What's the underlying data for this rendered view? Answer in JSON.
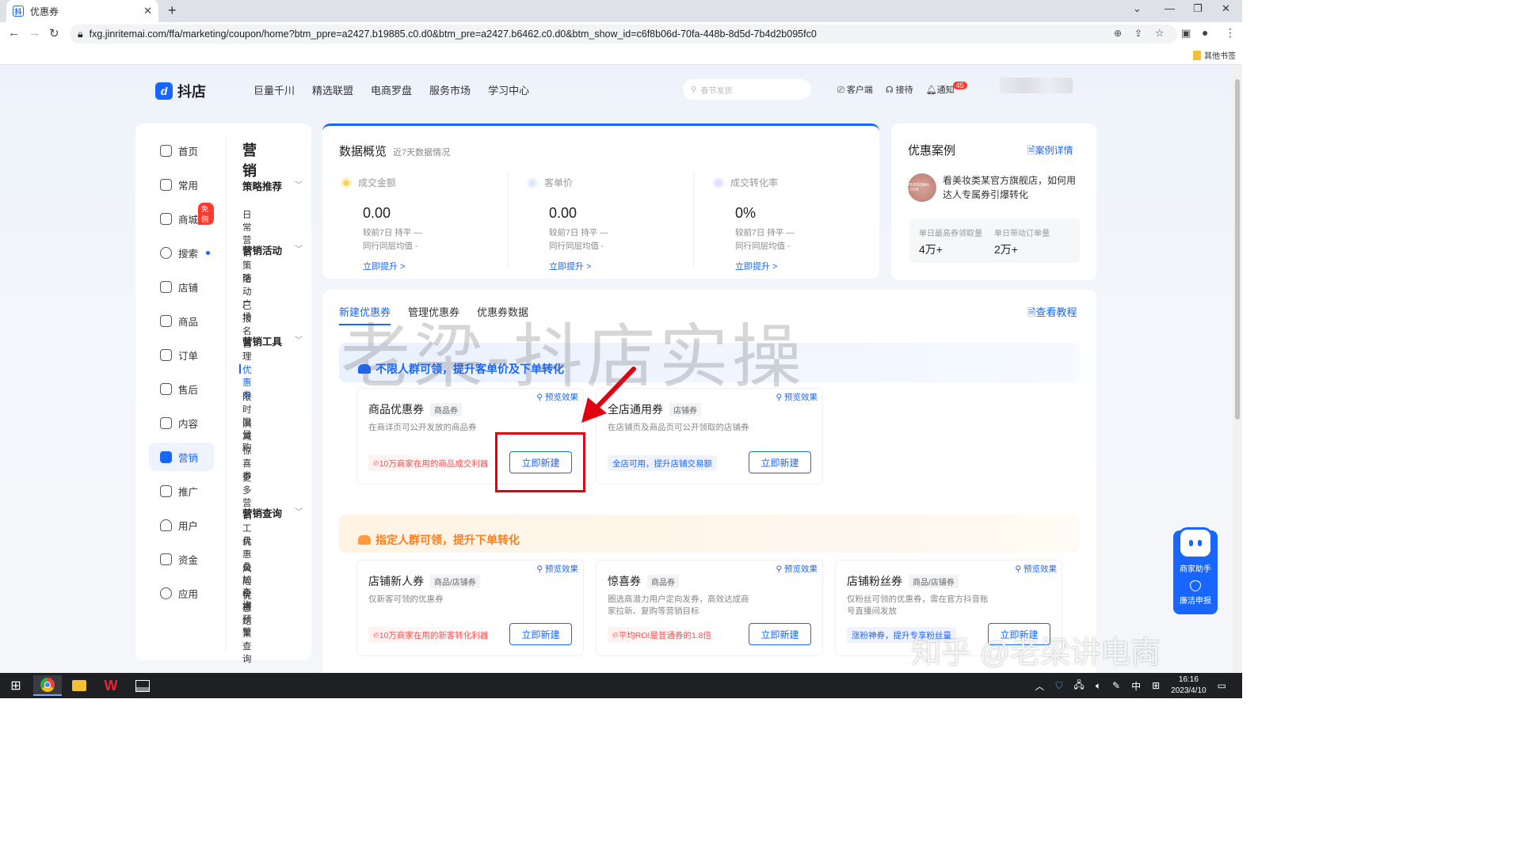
{
  "browser": {
    "tab_title": "优惠券",
    "tab_favicon": "抖",
    "url": "fxg.jinritemai.com/ffa/marketing/coupon/home?btm_ppre=a2427.b19885.c0.d0&btm_pre=a2427.b6462.c0.d0&btm_show_id=c6f8b06d-70fa-448b-8d5d-7b4d2b095fc0",
    "bookmarks_other": "其他书签"
  },
  "header": {
    "logo_text": "抖店",
    "nav": [
      "巨量千川",
      "精选联盟",
      "电商罗盘",
      "服务市场",
      "学习中心"
    ],
    "search_placeholder": "春节发货",
    "right": {
      "service": "客户端",
      "reception": "接待",
      "notice": "通知",
      "notice_badge": "45"
    }
  },
  "sidebar": {
    "primary": [
      {
        "label": "首页"
      },
      {
        "label": "常用"
      },
      {
        "label": "商城",
        "badge": "免佣"
      },
      {
        "label": "搜索"
      },
      {
        "label": "店铺"
      },
      {
        "label": "商品"
      },
      {
        "label": "订单"
      },
      {
        "label": "售后"
      },
      {
        "label": "内容"
      },
      {
        "label": "营销"
      },
      {
        "label": "推广"
      },
      {
        "label": "用户"
      },
      {
        "label": "资金"
      },
      {
        "label": "应用"
      }
    ],
    "secondary_title": "营销",
    "groups": [
      {
        "title": "策略推荐",
        "items": [
          "日常营销策略"
        ]
      },
      {
        "title": "营销活动",
        "items": [
          "活动广场",
          "已报名管理"
        ]
      },
      {
        "title": "营销工具",
        "items": [
          "优惠券",
          "限时限量购",
          "满减",
          "惊喜券",
          "更多营销工具"
        ]
      },
      {
        "title": "营销查询",
        "items": [
          "优惠叠加查询",
          "风险价格预警",
          "优惠结果查询"
        ]
      }
    ]
  },
  "overview": {
    "title": "数据概览",
    "subtitle": "近7天数据情况",
    "metrics": [
      {
        "label": "成交金额",
        "value": "0.00",
        "compare": "较前7日 持平 —",
        "peer": "同行同层均值 -",
        "link": "立即提升 >"
      },
      {
        "label": "客单价",
        "value": "0.00",
        "compare": "较前7日 持平 —",
        "peer": "同行同层均值 -",
        "link": "立即提升 >"
      },
      {
        "label": "成交转化率",
        "value": "0%",
        "compare": "较前7日 持平 —",
        "peer": "同行同层均值 -",
        "link": "立即提升 >"
      }
    ]
  },
  "cases": {
    "title": "优惠案例",
    "link": "案例详情",
    "avatar_text": "PERSONAL LOOK",
    "desc": "看美妆类某官方旗舰店，如何用达人专属券引爆转化",
    "stats": [
      {
        "label": "单日最高券领取量",
        "value": "4万+"
      },
      {
        "label": "单日带动订单量",
        "value": "2万+"
      }
    ]
  },
  "main": {
    "tabs": [
      "新建优惠券",
      "管理优惠券",
      "优惠券数据"
    ],
    "tutorial": "查看教程",
    "section1": "不限人群可领，提升客单价及下单转化",
    "section2": "指定人群可领，提升下单转化",
    "preview_label": "预览效果",
    "new_label": "立即新建",
    "cards": [
      {
        "title": "商品优惠券",
        "tag": "商品券",
        "desc": "在商详页可公开发放的商品券",
        "hint": "10万商家在用的商品成交利器"
      },
      {
        "title": "全店通用券",
        "tag": "店铺券",
        "desc": "在店铺页及商品页可公开领取的店铺券",
        "hint": "全店可用，提升店铺交易额"
      },
      {
        "title": "店铺新人券",
        "tag": "商品/店铺券",
        "desc": "仅新客可领的优惠券",
        "hint": "10万商家在用的新客转化利器"
      },
      {
        "title": "惊喜券",
        "tag": "商品券",
        "desc": "圈选高潜力用户定向发券，高效达成商家拉新、复购等营销目标",
        "hint": "平均ROI是普通券的1.8倍"
      },
      {
        "title": "店铺粉丝券",
        "tag": "商品/店铺券",
        "desc": "仅粉丝可领的优惠券，需在官方抖音账号直播间发放",
        "hint": "涨粉神券，提升专享粉丝量"
      }
    ]
  },
  "helper": {
    "title": "商家助手",
    "report": "廉洁申报"
  },
  "watermarks": {
    "center": "老梁-抖店实操",
    "corner": "知乎 @老梁讲电商"
  },
  "taskbar": {
    "ime": "中",
    "time": "16:16",
    "date": "2023/4/10"
  },
  "colors": {
    "brand": "#1966ff",
    "highlight": "#e00012",
    "warning": "#ff7d1a"
  }
}
